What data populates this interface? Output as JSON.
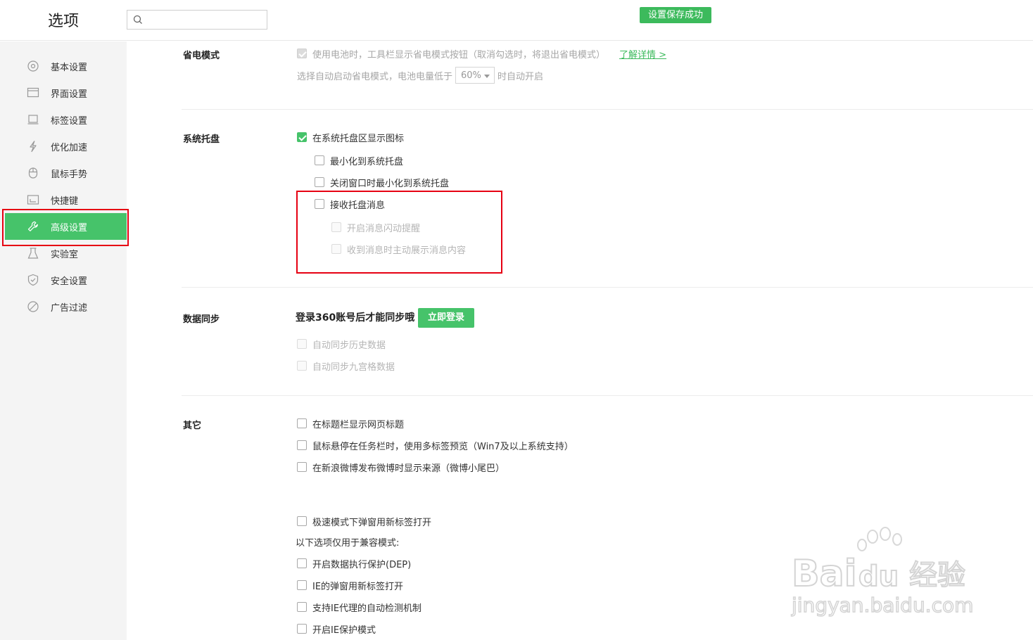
{
  "header": {
    "title": "选项",
    "search_placeholder": "",
    "toast": "设置保存成功"
  },
  "sidebar": {
    "items": [
      {
        "label": "基本设置",
        "icon": "settings-icon"
      },
      {
        "label": "界面设置",
        "icon": "window-icon"
      },
      {
        "label": "标签设置",
        "icon": "tab-icon"
      },
      {
        "label": "优化加速",
        "icon": "lightning-icon"
      },
      {
        "label": "鼠标手势",
        "icon": "mouse-icon"
      },
      {
        "label": "快捷键",
        "icon": "keyboard-icon"
      },
      {
        "label": "高级设置",
        "icon": "wrench-icon",
        "active": true
      },
      {
        "label": "实验室",
        "icon": "flask-icon"
      },
      {
        "label": "安全设置",
        "icon": "shield-icon"
      },
      {
        "label": "广告过滤",
        "icon": "block-icon"
      }
    ]
  },
  "power_saving": {
    "title": "省电模式",
    "battery_option": "使用电池时，工具栏显示省电模式按钮（取消勾选时，将退出省电模式）",
    "learn_more": "了解详情 >",
    "auto_prefix": "选择自动启动省电模式，电池电量低于",
    "auto_value": "60%",
    "auto_suffix": "时自动开启"
  },
  "tray": {
    "title": "系统托盘",
    "show_icon": "在系统托盘区显示图标",
    "minimize": "最小化到系统托盘",
    "close_minimize": "关闭窗口时最小化到系统托盘",
    "receive_msg": "接收托盘消息",
    "flash_alert": "开启消息闪动提醒",
    "show_content": "收到消息时主动展示消息内容"
  },
  "sync": {
    "title": "数据同步",
    "note": "登录360账号后才能同步哦",
    "login_button": "立即登录",
    "history": "自动同步历史数据",
    "grid": "自动同步九宫格数据"
  },
  "other": {
    "title": "其它",
    "show_page_title": "在标题栏显示网页标题",
    "taskbar_preview": "鼠标悬停在任务栏时，使用多标签预览（Win7及以上系统支持）",
    "weibo_source": "在新浪微博发布微博时显示来源（微博小尾巴）",
    "popup_new_tab": "极速模式下弹窗用新标签打开",
    "compat_note": "以下选项仅用于兼容模式:",
    "dep": "开启数据执行保护(DEP)",
    "ie_popup": "IE的弹窗用新标签打开",
    "ie_proxy": "支持IE代理的自动检测机制",
    "ie_protect": "开启IE保护模式"
  },
  "watermark": {
    "brand": "Bai",
    "brand2": "du",
    "cn": "经验",
    "url": "jingyan.baidu.com"
  },
  "colors": {
    "accent": "#46c36a",
    "annotation": "#e60012"
  }
}
